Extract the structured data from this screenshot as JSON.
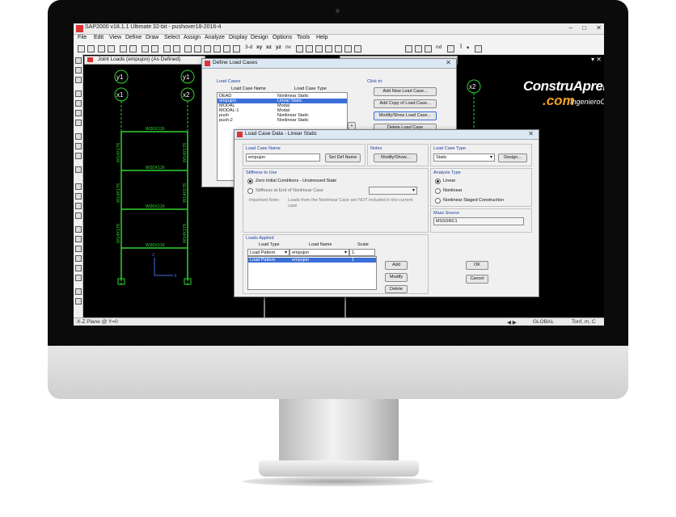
{
  "app": {
    "title": "SAP2000 v18.1.1 Ultimate 32-bit - pushover18-2016-4",
    "window_buttons": [
      "–",
      "□",
      "✕"
    ]
  },
  "menu": [
    "File",
    "Edit",
    "View",
    "Define",
    "Draw",
    "Select",
    "Assign",
    "Analyze",
    "Display",
    "Design",
    "Options",
    "Tools",
    "Help"
  ],
  "toolbar": {
    "view_buttons": [
      "3-d",
      "xy",
      "xz",
      "yz",
      "nv"
    ],
    "extra": [
      "nd",
      "I",
      "▾"
    ]
  },
  "views": {
    "view1_title": "Joint Loads (empujon) (As Defined)",
    "view2_title": "X-Z Plane @ Y=0"
  },
  "graphics": {
    "grid_bubbles_left": [
      "y1",
      "x1"
    ],
    "grid_bubbles_mid": [
      "y1",
      "x2"
    ],
    "grid_bubbles_right": [
      "x2"
    ],
    "beam_labels": [
      "W30X116",
      "W30X116",
      "W30X116",
      "W30X116"
    ],
    "column_labels": [
      "W14X176",
      "W14X176",
      "W14X176",
      "W14X176",
      "W14X176",
      "W14X176"
    ],
    "axis_z": "Z",
    "axis_x": "X"
  },
  "logo": {
    "line1": "ConstruAprende",
    "line2": ".com",
    "line3": "IngenieroCivil"
  },
  "status": {
    "left": "X-Z Plane @ Y=0",
    "coord_system": "GLOBAL",
    "units": "Tonf, m, C"
  },
  "define_load_cases": {
    "title": "Define Load Cases",
    "group_label": "Load Cases",
    "col_name": "Load Case Name",
    "col_type": "Load Case Type",
    "rows": [
      {
        "name": "DEAD",
        "type": "Nonlinear Static",
        "selected": false
      },
      {
        "name": "empujon",
        "type": "Linear Static",
        "selected": true
      },
      {
        "name": "MODAL",
        "type": "Modal",
        "selected": false
      },
      {
        "name": "MODAL-1",
        "type": "Modal",
        "selected": false
      },
      {
        "name": "push",
        "type": "Nonlinear Static",
        "selected": false
      },
      {
        "name": "push-2",
        "type": "Nonlinear Static",
        "selected": false
      }
    ],
    "click_to": "Click to:",
    "buttons": [
      "Add New Load Case...",
      "Add Copy of Load Case...",
      "Modify/Show Load Case...",
      "Delete Load Case"
    ]
  },
  "load_case_data": {
    "title": "Load Case Data - Linear Static",
    "name_label": "Load Case Name",
    "name_value": "empujon",
    "set_def_name": "Set Def Name",
    "notes_label": "Notes",
    "modify_show": "Modify/Show...",
    "type_label": "Load Case Type",
    "type_value": "Static",
    "design_btn": "Design...",
    "stiffness_label": "Stiffness to Use",
    "stiffness_opt1": "Zero Initial Conditions - Unstressed State",
    "stiffness_opt2": "Stiffness at End of Nonlinear Case",
    "important_note_label": "Important Note:",
    "important_note_text1": "Loads from the Nonlinear Case are NOT included in the current",
    "important_note_text2": "case",
    "analysis_type_label": "Analysis Type",
    "analysis_opt1": "Linear",
    "analysis_opt2": "Nonlinear",
    "analysis_opt3": "Nonlinear Staged Construction",
    "loads_applied_label": "Loads Applied",
    "col_load_type": "Load Type",
    "col_load_name": "Load Name",
    "col_scale": "Scale",
    "edit_row": {
      "load_type": "Load Pattern",
      "load_name": "empujon",
      "scale": "1."
    },
    "table_row": {
      "load_type": "Load Pattern",
      "load_name": "empujon",
      "scale": "1"
    },
    "add_btn": "Add",
    "modify_btn": "Modify",
    "delete_btn": "Delete",
    "mass_source_label": "Mass Source",
    "mass_source_value": "MSSSRC1",
    "ok_btn": "OK",
    "cancel_btn": "Cancel"
  }
}
